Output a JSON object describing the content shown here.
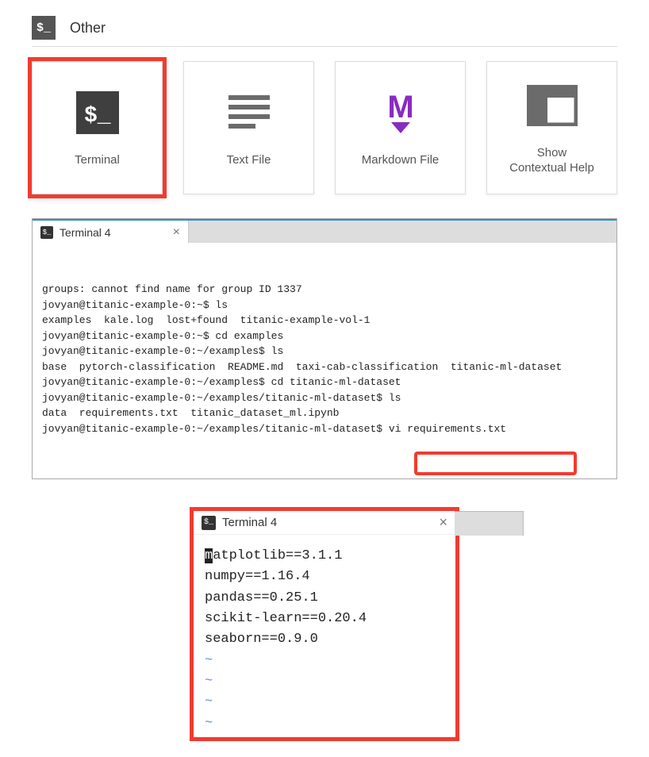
{
  "section": {
    "title": "Other",
    "icon_glyph": "$_"
  },
  "cards": [
    {
      "id": "terminal",
      "label": "Terminal",
      "selected": true
    },
    {
      "id": "text-file",
      "label": "Text File",
      "selected": false
    },
    {
      "id": "markdown-file",
      "label": "Markdown File",
      "selected": false
    },
    {
      "id": "contextual-help",
      "label": "Show\nContextual Help",
      "selected": false
    }
  ],
  "terminal1": {
    "tab_title": "Terminal 4",
    "lines": [
      "groups: cannot find name for group ID 1337",
      "jovyan@titanic-example-0:~$ ls",
      "examples  kale.log  lost+found  titanic-example-vol-1",
      "jovyan@titanic-example-0:~$ cd examples",
      "jovyan@titanic-example-0:~/examples$ ls",
      "base  pytorch-classification  README.md  taxi-cab-classification  titanic-ml-dataset",
      "jovyan@titanic-example-0:~/examples$ cd titanic-ml-dataset",
      "jovyan@titanic-example-0:~/examples/titanic-ml-dataset$ ls",
      "data  requirements.txt  titanic_dataset_ml.ipynb",
      "jovyan@titanic-example-0:~/examples/titanic-ml-dataset$ vi requirements.txt"
    ],
    "highlighted_command": "vi requirements.txt"
  },
  "vi_editor": {
    "tab_title": "Terminal 4",
    "cursor_char": "m",
    "first_line_rest": "atplotlib==3.1.1",
    "lines": [
      "numpy==1.16.4",
      "pandas==0.25.1",
      "scikit-learn==0.20.4",
      "seaborn==0.9.0"
    ],
    "tilde_count": 4
  }
}
